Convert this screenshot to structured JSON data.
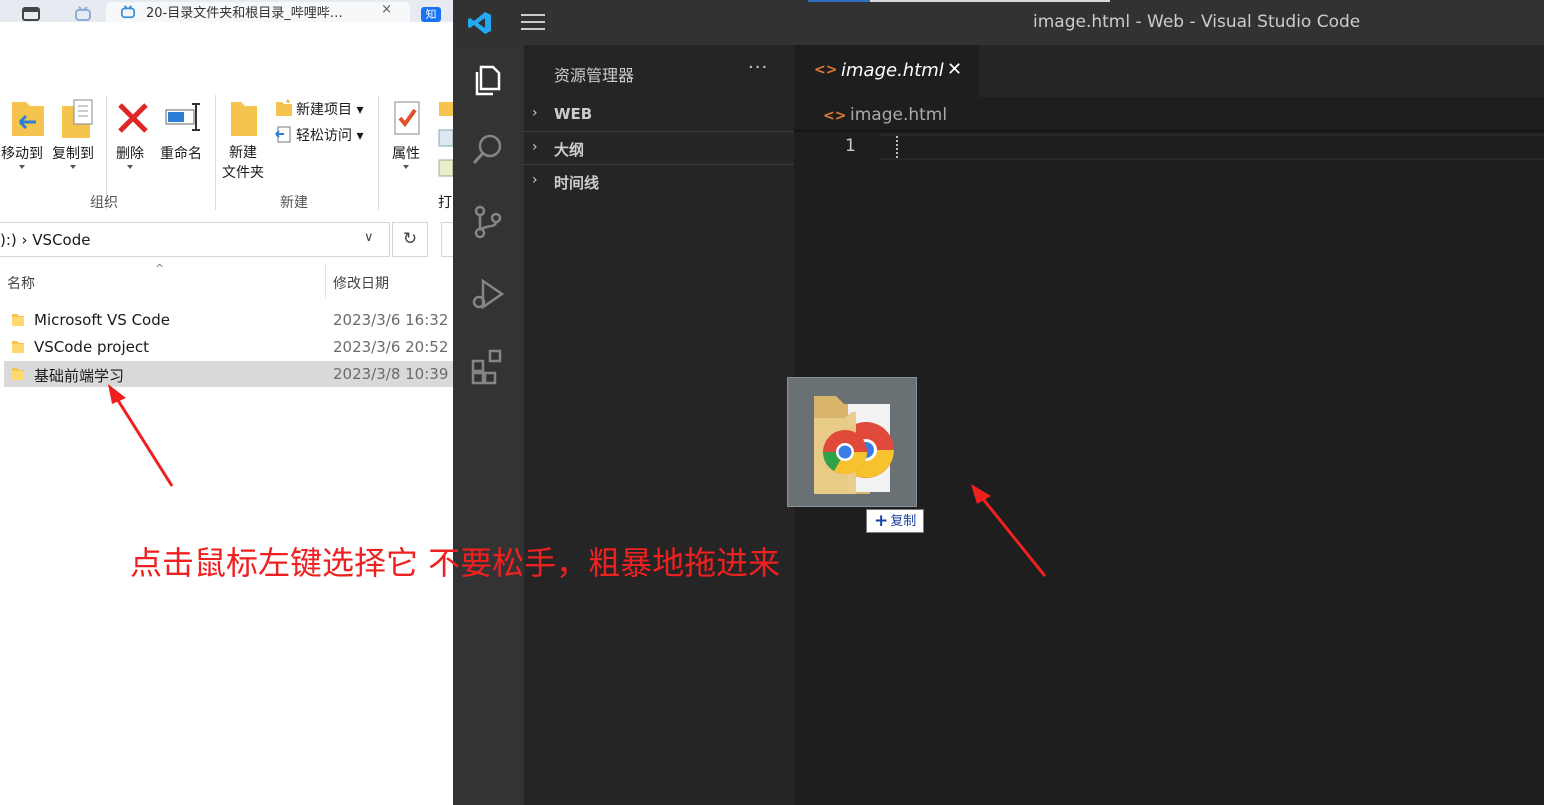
{
  "browser": {
    "active_tab_title": "20-目录文件夹和根目录_哔哩哔…",
    "close_glyph": "×",
    "zhihu_glyph": "知"
  },
  "explorer": {
    "ribbon": {
      "move_to": "移动到",
      "copy_to": "复制到",
      "delete": "删除",
      "rename": "重命名",
      "new_folder": "新建\n文件夹",
      "new_item": "新建项目",
      "easy_access": "轻松访问",
      "properties": "属性",
      "open_partial": "打",
      "group_organize": "组织",
      "group_new": "新建"
    },
    "address": {
      "path": "D:) > VSCode",
      "path_visible": "):)  ›  VSCode",
      "dropdown": "∨",
      "refresh": "↻"
    },
    "columns": {
      "name": "名称",
      "date_modified": "修改日期",
      "sort_glyph": "^"
    },
    "files": [
      {
        "name": "Microsoft VS Code",
        "date": "2023/3/6 16:32",
        "selected": false
      },
      {
        "name": "VSCode project",
        "date": "2023/3/6 20:52",
        "selected": false
      },
      {
        "name": "基础前端学习",
        "date": "2023/3/8 10:39",
        "selected": true
      }
    ]
  },
  "vscode": {
    "window_title": "image.html - Web - Visual Studio Code",
    "sidebar": {
      "title": "资源管理器",
      "more": "···",
      "sections": [
        {
          "label": "WEB",
          "chevron": "›"
        },
        {
          "label": "大纲",
          "chevron": "›"
        },
        {
          "label": "时间线",
          "chevron": "›"
        }
      ]
    },
    "editor": {
      "tab_label": "image.html",
      "tab_close": "✕",
      "breadcrumb": "image.html",
      "html_icon": "<>",
      "line_number": "1"
    },
    "activity_icons": [
      "explorer-icon",
      "search-icon",
      "source-control-icon",
      "run-debug-icon",
      "extensions-icon"
    ]
  },
  "drag": {
    "badge_plus": "+",
    "badge_text": "复制"
  },
  "annotation": {
    "instruction": "点击鼠标左键选择它 不要松手，粗暴地拖进来",
    "color": "#ef2020"
  }
}
